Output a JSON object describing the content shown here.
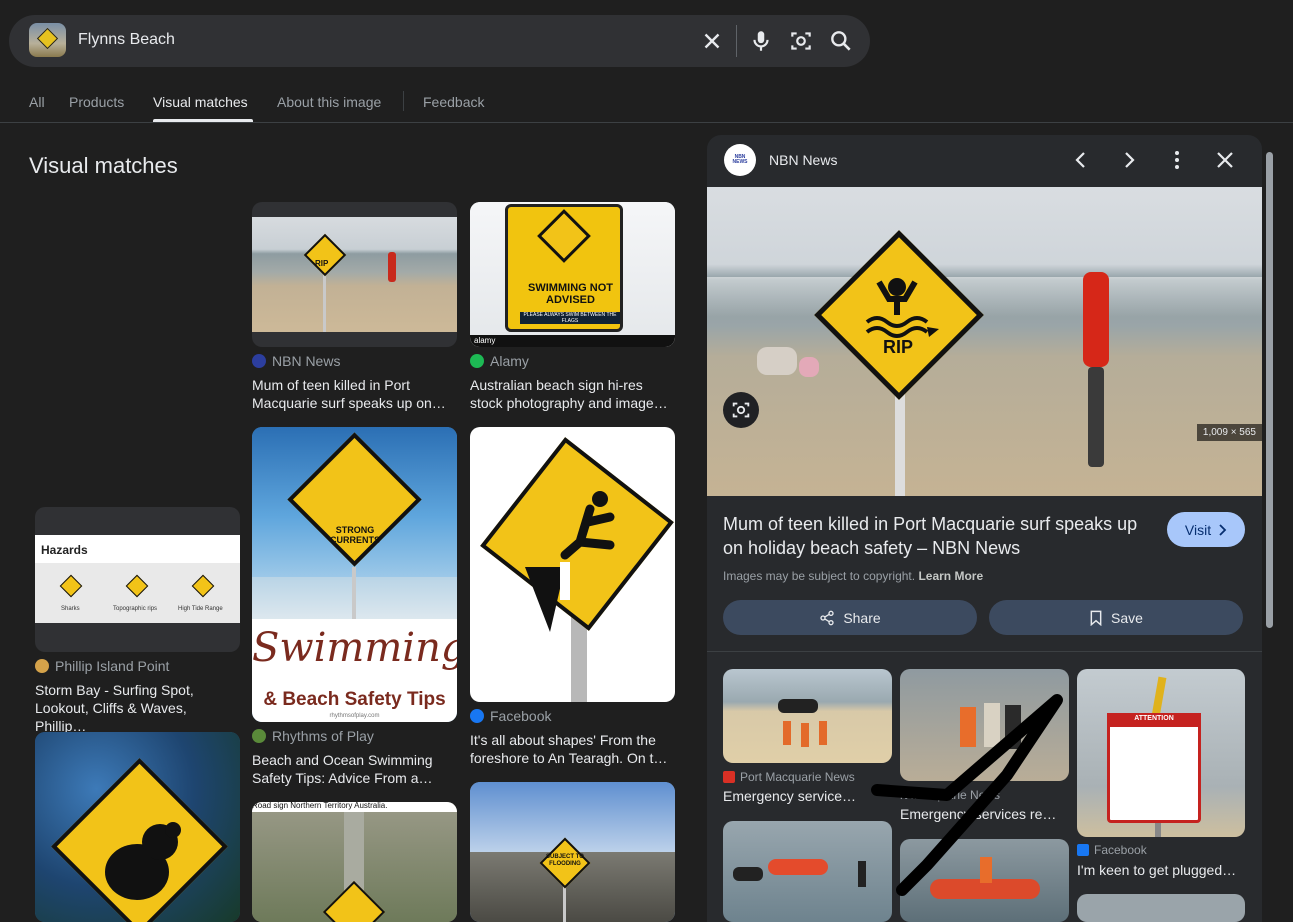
{
  "search": {
    "query": "Flynns Beach"
  },
  "tabs": [
    {
      "label": "All"
    },
    {
      "label": "Products"
    },
    {
      "label": "Visual matches"
    },
    {
      "label": "About this image"
    },
    {
      "label": "Feedback"
    }
  ],
  "results": {
    "heading": "Visual matches",
    "cards": [
      {
        "source": "NBN News",
        "title_line1": "Mum of teen killed in Port",
        "title_line2": "Macquarie surf speaks up on…",
        "sign_text": "RIP"
      },
      {
        "source": "Alamy",
        "title_line1": "Australian beach sign hi-res",
        "title_line2": "stock photography and image…",
        "sign_text": "SWIMMING NOT ADVISED",
        "sign_sub": "PLEASE ALWAYS SWIM BETWEEN THE FLAGS",
        "watermark": "alamy"
      },
      {
        "source": "Phillip Island Point",
        "title_line1": "Storm Bay - Surfing Spot,",
        "title_line2": "Lookout, Cliffs & Waves, Phillip…",
        "img_heading": "Hazards",
        "img_labels": [
          "Sharks",
          "Topographic rips",
          "High Tide Range"
        ]
      },
      {
        "source": "Rhythms of Play",
        "title_line1": "Beach and Ocean Swimming",
        "title_line2": "Safety Tips: Advice From a…",
        "sign_text": "STRONG CURRENTS",
        "overlay_line1": "Swimming",
        "overlay_line2": "& Beach Safety Tips",
        "footer": "rhythmsofplay.com"
      },
      {
        "source": "Facebook",
        "title_line1": "It's all about shapes' From the",
        "title_line2": "foreshore to An Tearagh. On t…"
      },
      {
        "caption": "Road sign Northern Territory Australia."
      },
      {
        "sign_text": "SUBJECT TO FLOODING"
      }
    ]
  },
  "panel": {
    "source": "NBN News",
    "logo_text": "NBN NEWS",
    "title": "Mum of teen killed in Port Macquarie surf speaks up on holiday beach safety – NBN News",
    "dimensions": "1,009 × 565",
    "sign_text": "RIP",
    "visit_label": "Visit",
    "copyright": "Images may be subject to copyright.",
    "learn_more": "Learn More",
    "share_label": "Share",
    "save_label": "Save",
    "related": [
      {
        "source": "Port Macquarie News",
        "title": "Emergency service…"
      },
      {
        "source": "Port Macquarie News",
        "source_visible": "rt Macquarie News",
        "title": "Emergency services re…"
      },
      {
        "source": "Facebook",
        "title": "I'm keen to get plugged…",
        "sign_title": "ATTENTION"
      }
    ]
  },
  "colors": {
    "accent": "#a8c7fa",
    "background": "#1f1f1f",
    "panel": "#282a2d",
    "sign_yellow": "#f2c318"
  }
}
